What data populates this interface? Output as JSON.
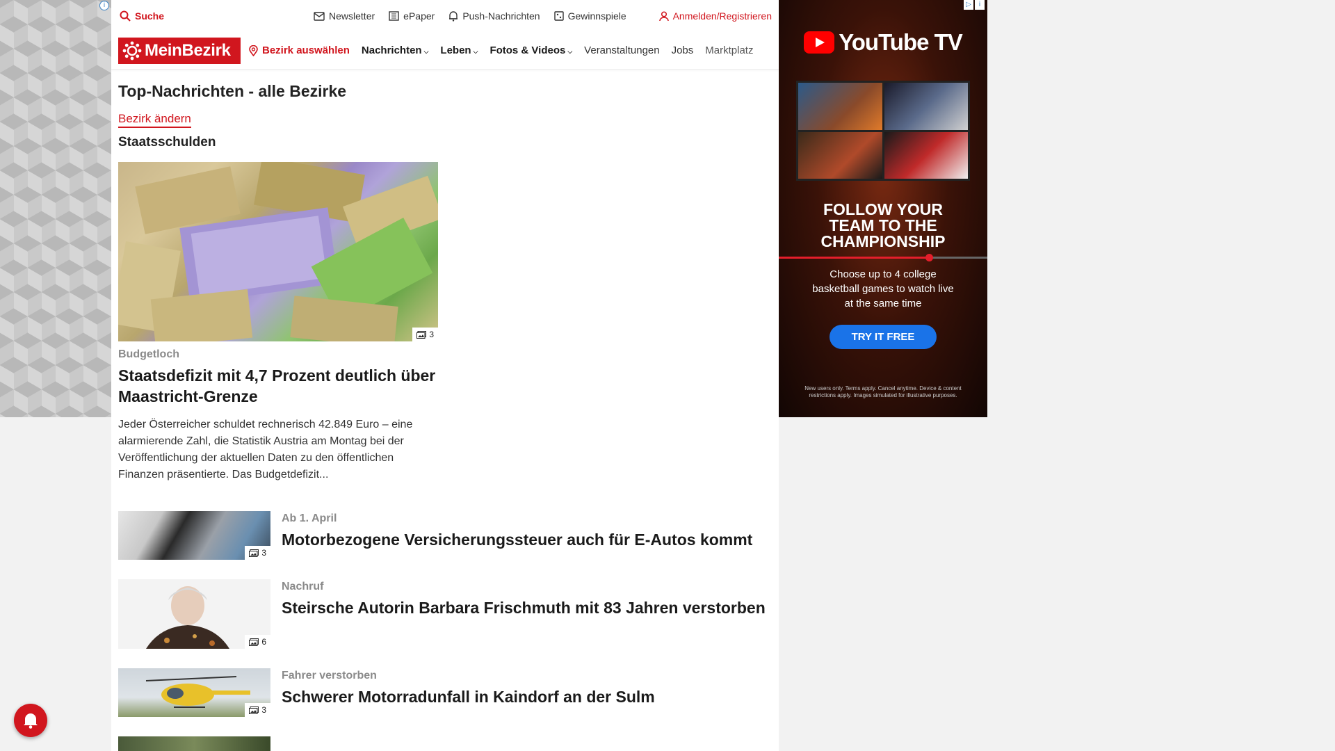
{
  "topbar": {
    "search_label": "Suche",
    "newsletter_label": "Newsletter",
    "epaper_label": "ePaper",
    "push_label": "Push-Nachrichten",
    "games_label": "Gewinnspiele",
    "login_label": "Anmelden/Registrieren"
  },
  "navbar": {
    "logo_text": "MeinBezirk",
    "bezirk_label": "Bezirk auswählen",
    "items": [
      "Nachrichten",
      "Leben",
      "Fotos & Videos",
      "Veranstaltungen",
      "Jobs",
      "Marktplatz"
    ]
  },
  "page": {
    "title": "Top-Nachrichten - alle Bezirke",
    "change_link": "Bezirk ändern",
    "section_title": "Staatsschulden"
  },
  "feature": {
    "image_count": "3",
    "kicker": "Budgetloch",
    "title": "Staatsdefizit mit 4,7 Prozent deutlich über Maastricht-Grenze",
    "text": "Jeder Österreicher schuldet rechnerisch 42.849 Euro – eine alarmierende Zahl, die Statistik Austria am Montag bei der Veröffentlichung der aktuellen Daten zu den öffentlichen Finanzen präsentierte. Das Budgetdefizit..."
  },
  "articles": [
    {
      "kicker": "Ab 1. April",
      "title": "Motorbezogene Versicherungssteuer auch für E-Autos kommt",
      "image_count": "3"
    },
    {
      "kicker": "Nachruf",
      "title": "Steirsche Autorin Barbara Frischmuth mit 83 Jahren verstorben",
      "image_count": "6"
    },
    {
      "kicker": "Fahrer verstorben",
      "title": "Schwerer Motorradunfall in Kaindorf an der Sulm",
      "image_count": "3"
    }
  ],
  "ad": {
    "brand": "YouTube TV",
    "headline": "FOLLOW YOUR TEAM TO THE CHAMPIONSHIP",
    "progress": 0.72,
    "subtext": "Choose up to 4 college basketball games to watch live at the same time",
    "cta": "TRY IT FREE",
    "fine_print": "New users only. Terms apply. Cancel anytime. Device & content restrictions apply. Images simulated for illustrative purposes."
  },
  "colors": {
    "brand_red": "#d1161e",
    "ad_button": "#1a73e8",
    "youtube_red": "#ff0000"
  },
  "icons": [
    "search-icon",
    "mail-icon",
    "newspaper-icon",
    "bell-icon",
    "gift-icon",
    "user-icon",
    "location-pin-icon",
    "chevron-down-icon",
    "gallery-icon",
    "notification-bell-icon"
  ]
}
